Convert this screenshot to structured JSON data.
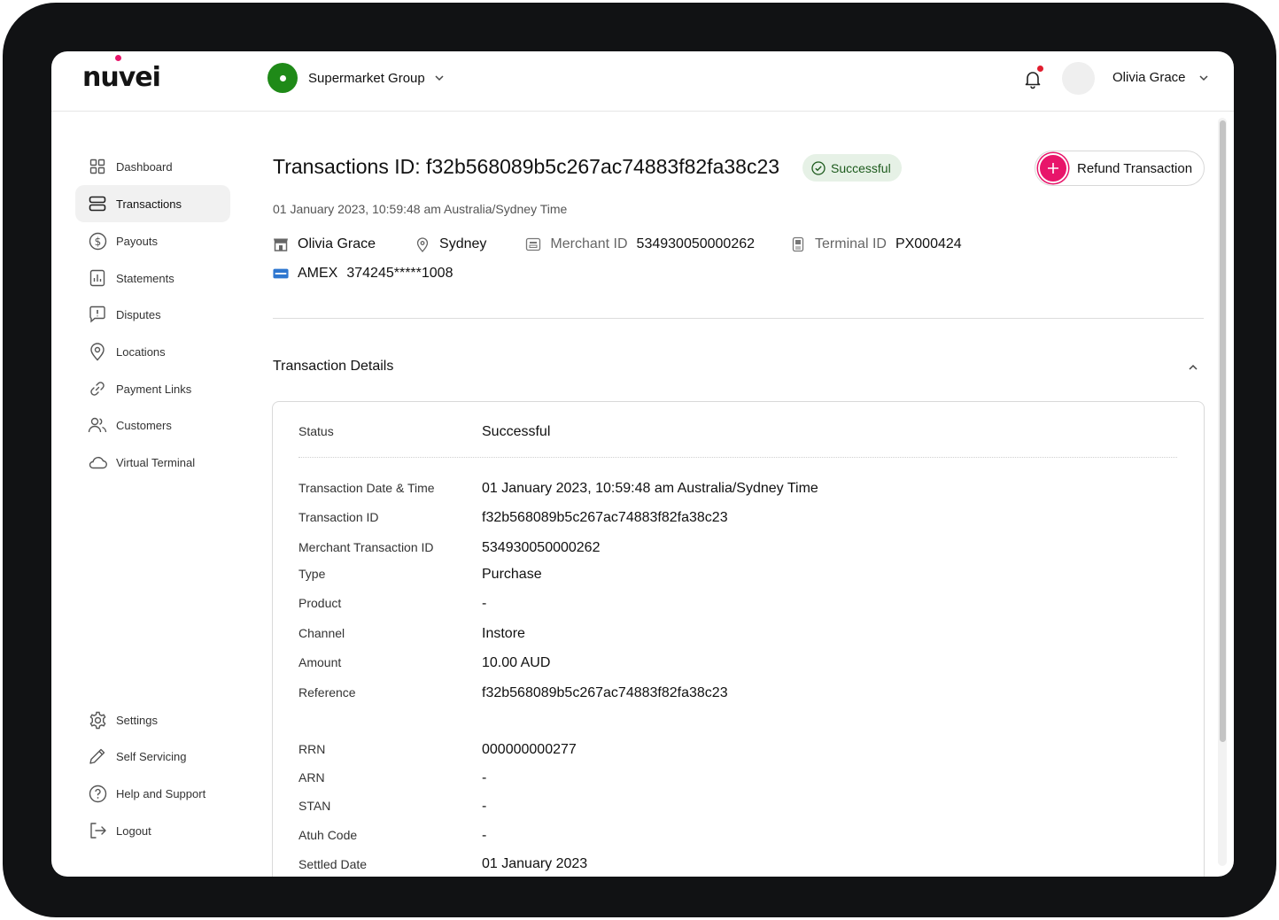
{
  "header": {
    "logo_text": "nuvei",
    "org_name": "Supermarket Group",
    "user_name": "Olivia Grace"
  },
  "sidebar": {
    "items": [
      {
        "label": "Dashboard",
        "icon": "grid-icon"
      },
      {
        "label": "Transactions",
        "icon": "list-icon",
        "active": true
      },
      {
        "label": "Payouts",
        "icon": "dollar-icon"
      },
      {
        "label": "Statements",
        "icon": "report-icon"
      },
      {
        "label": "Disputes",
        "icon": "chat-alert-icon"
      },
      {
        "label": "Locations",
        "icon": "location-pin-icon"
      },
      {
        "label": "Payment Links",
        "icon": "link-icon"
      },
      {
        "label": "Customers",
        "icon": "users-icon"
      },
      {
        "label": "Virtual Terminal",
        "icon": "cloud-icon"
      }
    ],
    "bottom_items": [
      {
        "label": "Settings",
        "icon": "gear-icon"
      },
      {
        "label": "Self Servicing",
        "icon": "pencil-icon"
      },
      {
        "label": "Help and Support",
        "icon": "help-icon"
      },
      {
        "label": "Logout",
        "icon": "logout-icon"
      }
    ]
  },
  "main": {
    "title": "Transactions ID: f32b568089b5c267ac74883f82fa38c23",
    "status_badge": "Successful",
    "refund_button": "Refund Transaction",
    "date_line": "01 January 2023, 10:59:48 am Australia/Sydney Time",
    "meta": {
      "merchant_name": "Olivia Grace",
      "location": "Sydney",
      "merchant_id_label": "Merchant ID",
      "merchant_id": "534930050000262",
      "terminal_id_label": "Terminal ID",
      "terminal_id": "PX000424",
      "card_brand": "AMEX",
      "card_number": "374245*****1008"
    },
    "section_title": "Transaction Details",
    "details": [
      {
        "label": "Status",
        "value": "Successful"
      },
      {
        "label": "Transaction Date & Time",
        "value": "01 January 2023, 10:59:48 am Australia/Sydney Time"
      },
      {
        "label": "Transaction ID",
        "value": "f32b568089b5c267ac74883f82fa38c23"
      },
      {
        "label": "Merchant Transaction ID",
        "value": "534930050000262"
      },
      {
        "label": "Type",
        "value": "Purchase"
      },
      {
        "label": "Product",
        "value": "-"
      },
      {
        "label": "Channel",
        "value": "Instore"
      },
      {
        "label": "Amount",
        "value": "10.00 AUD"
      },
      {
        "label": "Reference",
        "value": "f32b568089b5c267ac74883f82fa38c23"
      },
      {
        "label": "RRN",
        "value": "000000000277"
      },
      {
        "label": "ARN",
        "value": "-"
      },
      {
        "label": "STAN",
        "value": "-"
      },
      {
        "label": "Atuh Code",
        "value": "-"
      },
      {
        "label": "Settled Date",
        "value": "01 January 2023"
      }
    ]
  },
  "colors": {
    "brand_pink": "#e8156a",
    "org_green": "#1f8a18",
    "success_bg": "#e6f1e6",
    "success_text": "#1c5a1c"
  }
}
